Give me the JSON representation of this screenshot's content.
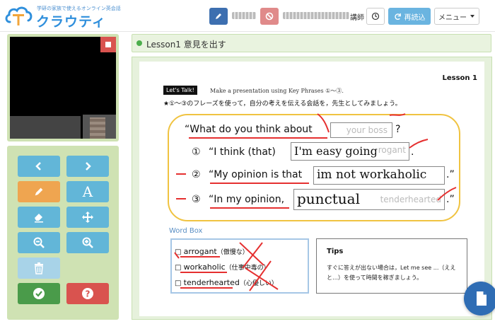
{
  "app": {
    "tagline": "学研の家族で使えるオンライン英会話",
    "name": "クラウティ"
  },
  "header": {
    "teacher_suffix": "講師",
    "reload_label": "再読込",
    "menu_label": "メニュー"
  },
  "lesson": {
    "title": "Lesson1 意見を出す"
  },
  "document": {
    "lesson_number": "Lesson 1",
    "lets_talk": "Let's Talk!",
    "instruction_en": "Make a presentation using Key Phrases ①〜③.",
    "instruction_jp": "★①〜③のフレーズを使って，自分の考えを伝える会話を，先生としてみましょう。",
    "question_prefix": "“What do you think about",
    "question_placeholder": "your boss",
    "question_suffix": "?",
    "phrases": [
      {
        "num": "①",
        "prefix": "“I think (that)",
        "handwritten": "I'm easy going",
        "placeholder": "rogant",
        "suffix": "."
      },
      {
        "num": "②",
        "prefix": "“My opinion is that",
        "handwritten": "im not workaholic",
        "placeholder": "",
        "suffix": ".”"
      },
      {
        "num": "③",
        "prefix": "“In my opinion,",
        "handwritten": "punctual",
        "placeholder": "tenderhearted",
        "suffix": ".”"
      }
    ],
    "word_box_label": "Word Box",
    "words": [
      {
        "word": "arrogant",
        "meaning": "（傲慢な）"
      },
      {
        "word": "workaholic",
        "meaning": "（仕事中毒の）"
      },
      {
        "word": "tenderhearted",
        "meaning": "（心優しい）"
      }
    ],
    "tips_title": "Tips",
    "tips_text": "すぐに答えが出ない場合は，Let me see ...（ええと…）を使って時間を稼ぎましょう。"
  },
  "icons": {
    "pen": "pencil-icon",
    "ban": "ban-icon",
    "clock": "clock-icon",
    "reload": "refresh-icon",
    "menu_caret": "caret-down-icon",
    "stop": "stop-icon",
    "prev": "chevron-left-icon",
    "next": "chevron-right-icon",
    "text_tool": "A",
    "eraser": "eraser-icon",
    "move": "move-icon",
    "zoom_out": "zoom-out-icon",
    "zoom_in": "zoom-in-icon",
    "trash": "trash-icon",
    "check": "check-icon",
    "help": "question-icon",
    "file": "file-icon"
  },
  "colors": {
    "brand_blue": "#2f8fdc",
    "accent_green": "#4cae4c",
    "panel_green": "#cfe2b3",
    "pen_blue": "#3d6fb0",
    "highlight_yellow": "#f0c341",
    "annotation_red": "#e53030"
  }
}
